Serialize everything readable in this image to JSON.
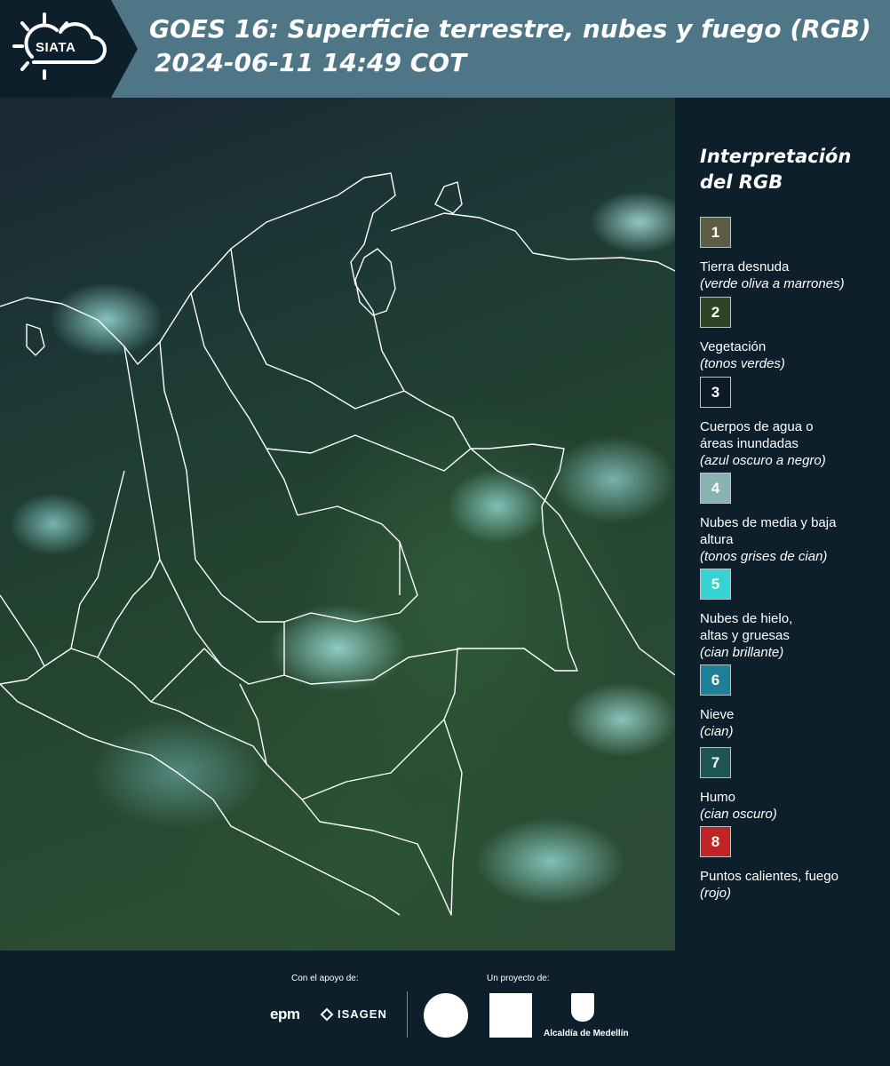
{
  "header": {
    "logo_text": "SIATA",
    "title_line1": "GOES 16: Superficie terrestre, nubes y fuego (RGB)",
    "title_line2": "2024-06-11 14:49 COT",
    "bg_color": "#4f7686"
  },
  "legend": {
    "title_line1": "Interpretación",
    "title_line2": "del RGB",
    "items": [
      {
        "number": "1",
        "label": "Tierra desnuda",
        "desc": "(verde oliva a marrones)",
        "color": "#5c5d43"
      },
      {
        "number": "2",
        "label": "Vegetación",
        "desc": "(tonos verdes)",
        "color": "#2f4422"
      },
      {
        "number": "3",
        "label": "Cuerpos de agua o áreas inundadas",
        "desc": "(azul oscuro a negro)",
        "color": "#0a1a26"
      },
      {
        "number": "4",
        "label": "Nubes de media y baja altura",
        "desc": "(tonos grises de cian)",
        "color": "#88b3b0"
      },
      {
        "number": "5",
        "label": "Nubes de hielo, altas y gruesas",
        "desc": "(cian brillante)",
        "color": "#34d4d4"
      },
      {
        "number": "6",
        "label": "Nieve",
        "desc": "(cian)",
        "color": "#1e8098"
      },
      {
        "number": "7",
        "label": "Humo",
        "desc": "(cian oscuro)",
        "color": "#1f5454"
      },
      {
        "number": "8",
        "label": "Puntos calientes, fuego",
        "desc": "(rojo)",
        "color": "#c02424"
      }
    ]
  },
  "footer": {
    "support_label": "Con el apoyo de:",
    "project_label": "Un proyecto de:",
    "epm": "epm",
    "isagen": "ISAGEN",
    "alcaldia": "Alcaldía de Medellín"
  }
}
